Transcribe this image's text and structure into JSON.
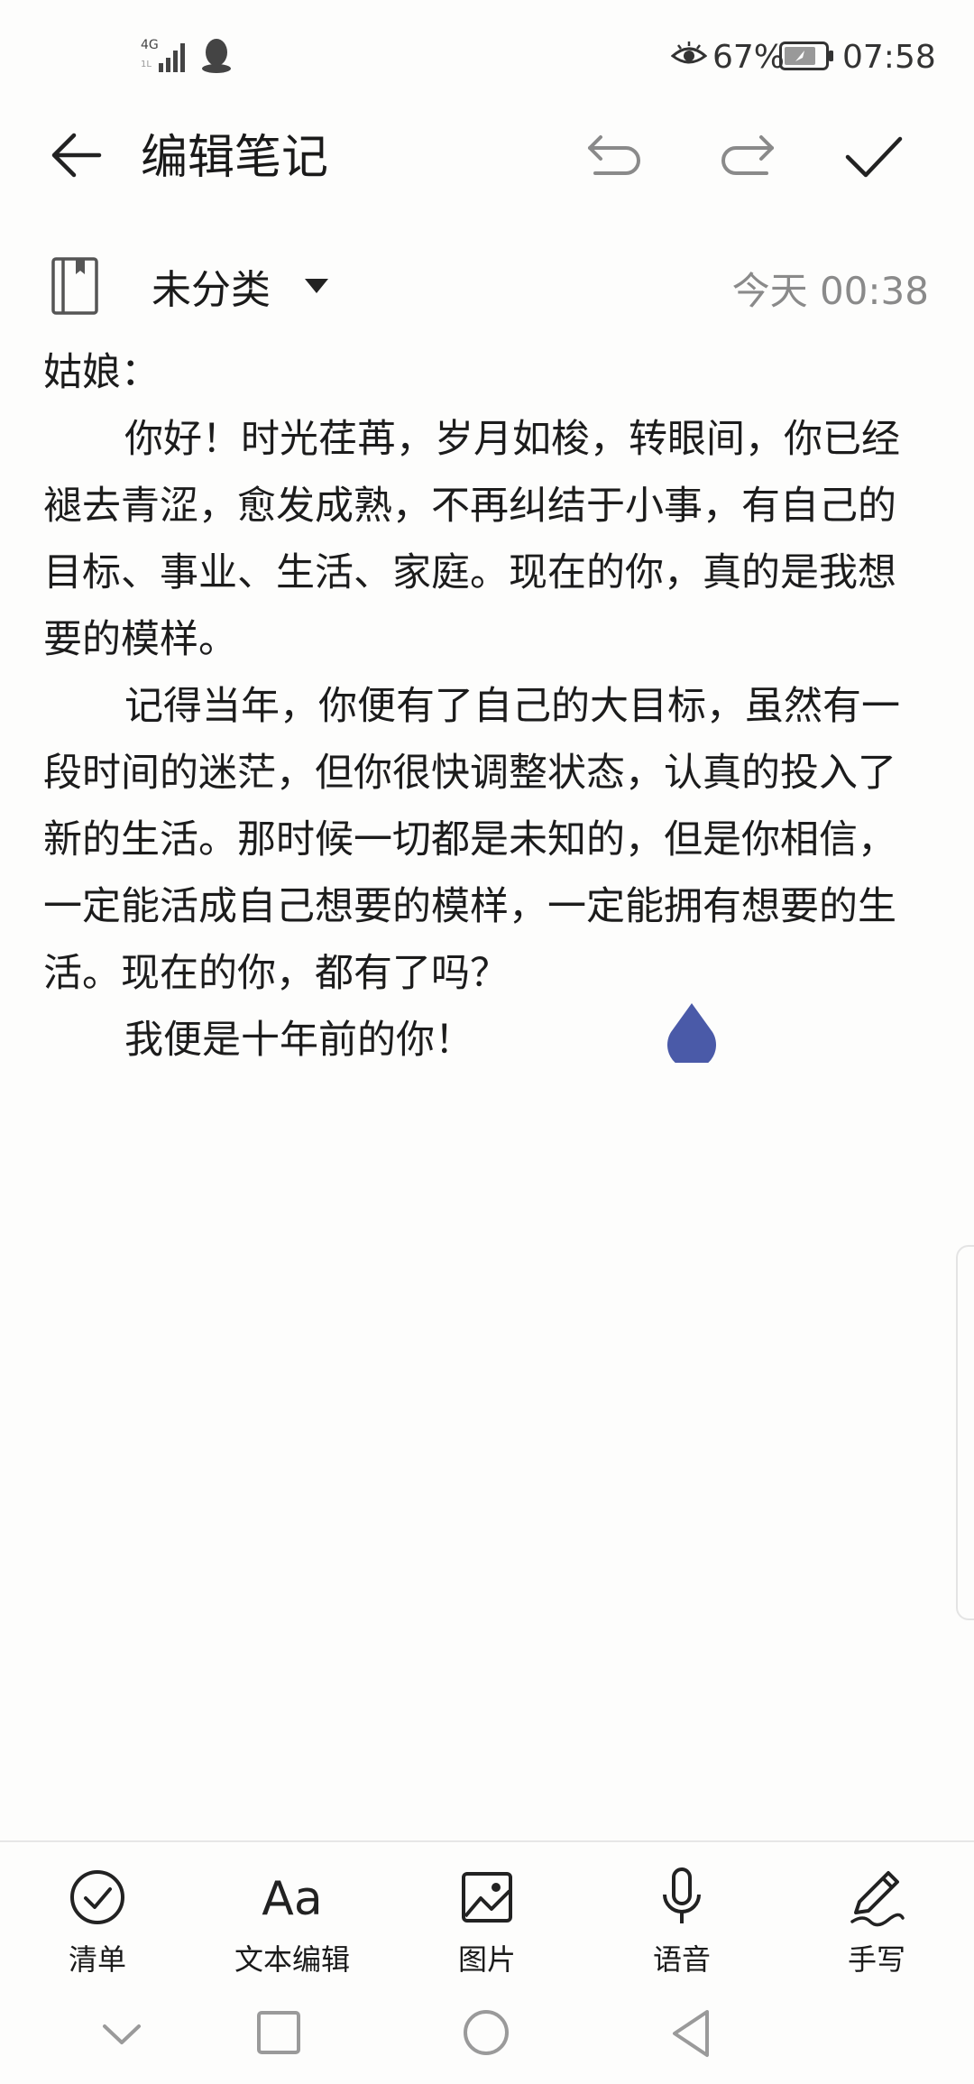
{
  "status_bar": {
    "network": "4G",
    "battery_percent": "67%",
    "time": "07:58",
    "icons": [
      "signal-icon",
      "qq-icon",
      "eye-comfort-icon",
      "battery-icon"
    ]
  },
  "header": {
    "title": "编辑笔记",
    "icons": [
      "back-arrow-icon",
      "undo-icon",
      "redo-icon",
      "check-icon"
    ]
  },
  "category": {
    "label": "未分类",
    "timestamp": "今天 00:38",
    "icons": [
      "notebook-icon",
      "dropdown-triangle-icon"
    ]
  },
  "note": {
    "salutation": "姑娘：",
    "paragraphs": [
      "你好！时光荏苒，岁月如梭，转眼间，你已经褪去青涩，愈发成熟，不再纠结于小事，有自己的目标、事业、生活、家庭。现在的你，真的是我想要的模样。",
      "记得当年，你便有了自己的大目标，虽然有一段时间的迷茫，但你很快调整状态，认真的投入了新的生活。那时候一切都是未知的，但是你相信，一定能活成自己想要的模样，一定能拥有想要的生活。现在的你，都有了吗？",
      "我便是十年前的你！"
    ]
  },
  "toolbar": {
    "items": [
      {
        "label": "清单",
        "icon": "checklist-icon"
      },
      {
        "label": "文本编辑",
        "icon": "text-format-icon"
      },
      {
        "label": "图片",
        "icon": "image-icon"
      },
      {
        "label": "语音",
        "icon": "microphone-icon"
      },
      {
        "label": "手写",
        "icon": "handwriting-pen-icon"
      }
    ]
  },
  "nav_bar": {
    "icons": [
      "collapse-icon",
      "recents-icon",
      "home-icon",
      "back-icon"
    ]
  },
  "colors": {
    "accent_cursor": "#4a5aa8",
    "text": "#1c1c1c",
    "muted": "#8a8a8a",
    "background": "#fdfdfc"
  }
}
